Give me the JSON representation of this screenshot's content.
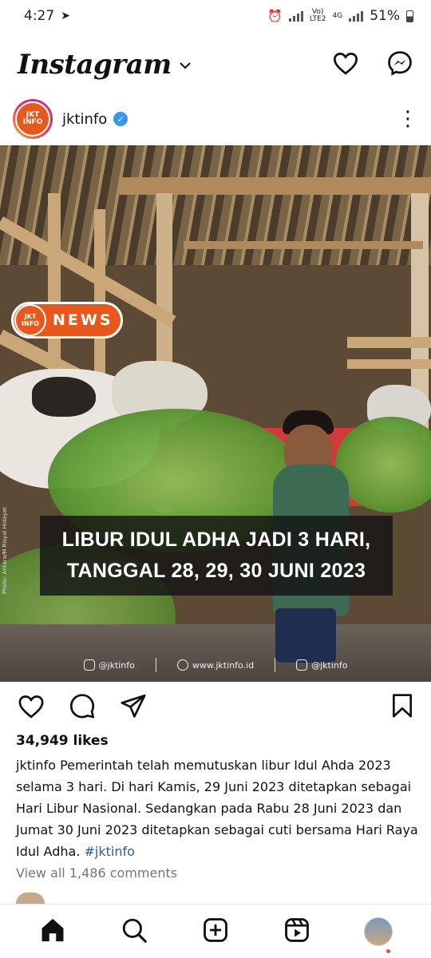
{
  "status_bar": {
    "time": "4:27",
    "net_top": "Vo)",
    "net_bottom": "LTE2",
    "net_type": "4G",
    "battery": "51%"
  },
  "header": {
    "logo": "Instagram"
  },
  "post": {
    "username": "jktinfo",
    "avatar_text_top": "JKT",
    "avatar_text_bottom": "INFO",
    "image": {
      "badge_label": "NEWS",
      "badge_logo_top": "JKT",
      "badge_logo_bottom": "INFO",
      "headline_line1": "LIBUR IDUL ADHA JADI 3 HARI,",
      "headline_line2": "TANGGAL 28, 29, 30 JUNI 2023",
      "photo_credit": "Photo: Antara/M Risyal Hidayat",
      "socials": [
        "@jktinfo",
        "www.jktinfo.id",
        "@jktinfo"
      ]
    },
    "likes": "34,949 likes",
    "caption_user": "jktinfo",
    "caption_text": "Pemerintah telah memutuskan libur Idul Ahda 2023 selama 3 hari. Di hari Kamis, 29 Juni 2023 ditetapkan sebagai Hari Libur Nasional. Sedangkan pada Rabu 28 Juni 2023 dan Jumat 30 Juni 2023 ditetapkan sebagai cuti bersama Hari Raya Idul Adha.",
    "caption_tag": "#jktinfo",
    "comments_link": "View all 1,486 comments"
  },
  "icons": {
    "header": [
      "heart-icon",
      "messenger-icon"
    ],
    "actions": [
      "heart-icon",
      "comment-icon",
      "share-icon",
      "bookmark-icon"
    ],
    "bottom_nav": [
      "home-icon",
      "search-icon",
      "create-icon",
      "reels-icon",
      "profile-avatar"
    ]
  },
  "colors": {
    "accent": "#e8581c",
    "verified": "#3897f0",
    "link": "#2a5d99",
    "notification": "#ed4956"
  }
}
